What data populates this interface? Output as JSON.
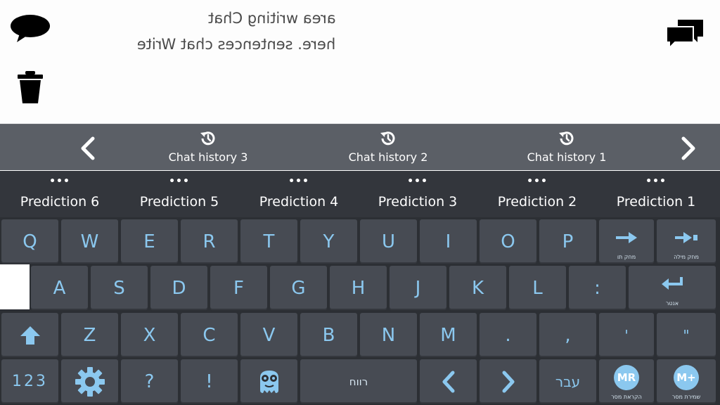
{
  "chat": {
    "lines": [
      "area writing Chat",
      "here. sentences chat Write"
    ]
  },
  "top_icons": [
    "speech-bubble-icon",
    "trash-icon",
    "chat-bubbles-icon"
  ],
  "history": {
    "items": [
      "Chat history 3",
      "Chat history 2",
      "Chat history 1"
    ]
  },
  "predictions": {
    "dots": "•••",
    "items": [
      "Prediction 6",
      "Prediction 5",
      "Prediction 4",
      "Prediction 3",
      "Prediction 2",
      "Prediction 1"
    ]
  },
  "keyboard": {
    "row1": [
      "Q",
      "W",
      "E",
      "R",
      "T",
      "Y",
      "U",
      "I",
      "O",
      "P"
    ],
    "row1_actions": [
      "מחק תו",
      "מחק מילה"
    ],
    "row2": [
      "A",
      "S",
      "D",
      "F",
      "G",
      "H",
      "J",
      "K",
      "L",
      ":"
    ],
    "enter_label": "אנטר",
    "row3": [
      "Z",
      "X",
      "C",
      "V",
      "B",
      "N",
      "M",
      ".",
      ",",
      "'",
      "\""
    ],
    "numbers_label": "123",
    "question": "?",
    "exclaim": "!",
    "space_label": "רווח",
    "language_label": "עבר",
    "mr_label": "MR",
    "mr_caption": "הקראת מסר",
    "mplus_label": "M+",
    "mplus_caption": "שמירת מסר"
  },
  "colors": {
    "key_bg": "#474b53",
    "key_text": "#8bc8ef",
    "keyboard_bg": "#2c2f34",
    "history_bg": "#5b5f66",
    "prediction_bg": "#33363c"
  }
}
